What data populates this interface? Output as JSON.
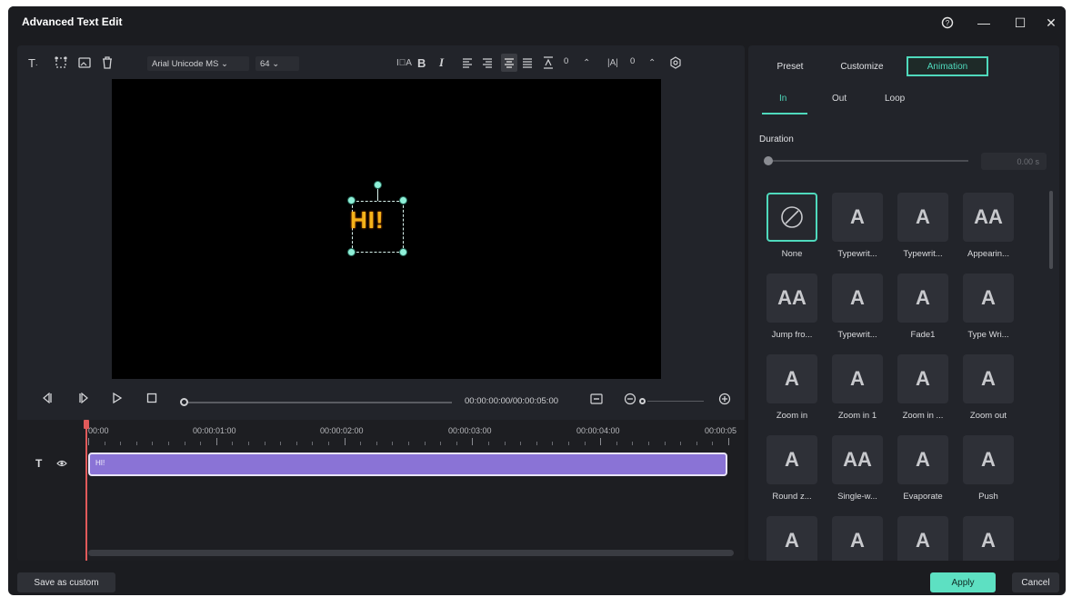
{
  "window": {
    "title": "Advanced Text Edit",
    "help": "?",
    "minimize": "—",
    "maximize": "☐",
    "close": "✕"
  },
  "toolbar": {
    "font": "Arial Unicode MS ⌄",
    "size": "64 ⌄",
    "bold": "B",
    "italic": "I",
    "spacing_value": "0",
    "kerning_value": "0"
  },
  "preview": {
    "text": "HI!"
  },
  "playback": {
    "timecode": "00:00:00:00/00:00:05:00"
  },
  "timeline": {
    "ruler": [
      "00:00",
      "00:00:01:00",
      "00:00:02:00",
      "00:00:03:00",
      "00:00:04:00",
      "00:00:05"
    ],
    "clip_label": "HI!",
    "track_icon": "T"
  },
  "panel": {
    "tabs": [
      "Preset",
      "Customize",
      "Animation"
    ],
    "subtabs": [
      "In",
      "Out",
      "Loop"
    ],
    "duration_label": "Duration",
    "duration_value": "0.00   s",
    "presets": [
      {
        "label": "None",
        "icon": "none-icon"
      },
      {
        "label": "Typewrit...",
        "icon": "typewriter-icon"
      },
      {
        "label": "Typewrit...",
        "icon": "typewriter-icon"
      },
      {
        "label": "Appearin...",
        "icon": "appearing-icon"
      },
      {
        "label": "Jump fro...",
        "icon": "jump-icon"
      },
      {
        "label": "Typewrit...",
        "icon": "typewriter-icon"
      },
      {
        "label": "Fade1",
        "icon": "fade-icon"
      },
      {
        "label": "Type Wri...",
        "icon": "typewriter-icon"
      },
      {
        "label": "Zoom in",
        "icon": "zoom-in-icon"
      },
      {
        "label": "Zoom in 1",
        "icon": "zoom-in-icon"
      },
      {
        "label": "Zoom in ...",
        "icon": "zoom-in-icon"
      },
      {
        "label": "Zoom out",
        "icon": "zoom-out-icon"
      },
      {
        "label": "Round z...",
        "icon": "round-zoom-icon"
      },
      {
        "label": "Single-w...",
        "icon": "single-word-icon"
      },
      {
        "label": "Evaporate",
        "icon": "evaporate-icon"
      },
      {
        "label": "Push",
        "icon": "push-icon"
      },
      {
        "label": "",
        "icon": "animation-icon"
      },
      {
        "label": "",
        "icon": "animation-icon"
      },
      {
        "label": "",
        "icon": "animation-icon"
      },
      {
        "label": "",
        "icon": "animation-icon"
      }
    ]
  },
  "footer": {
    "save": "Save as custom",
    "apply": "Apply",
    "cancel": "Cancel"
  },
  "colors": {
    "accent": "#4fd9bc",
    "clip": "#8a73d6",
    "text_fill": "#f4b21a"
  }
}
